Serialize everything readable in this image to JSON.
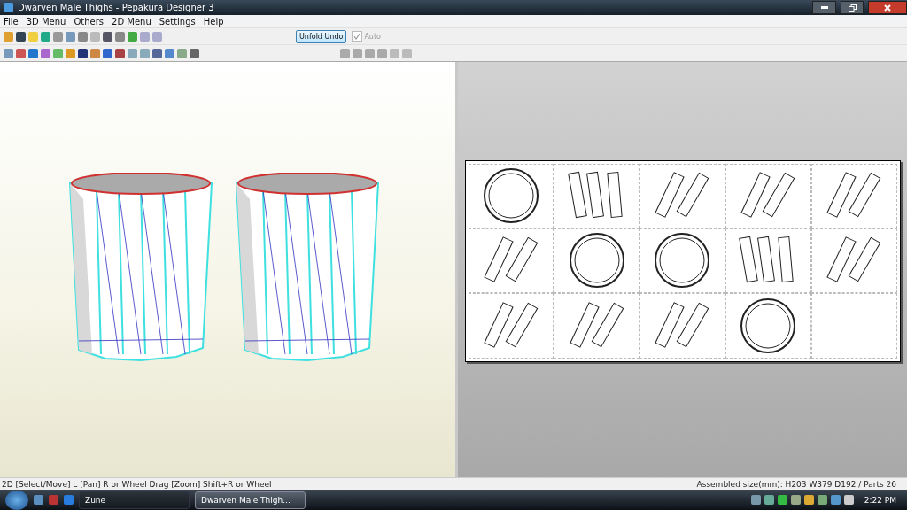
{
  "window": {
    "title": "Dwarven Male Thighs - Pepakura Designer 3"
  },
  "menu": [
    "File",
    "3D Menu",
    "Others",
    "2D Menu",
    "Settings",
    "Help"
  ],
  "unfold_undo": {
    "label": "Unfold Undo"
  },
  "auto": {
    "label": "Auto",
    "checked": true,
    "disabled": true
  },
  "sheet": {
    "cells": [
      {
        "kind": "ring"
      },
      {
        "kind": "trio"
      },
      {
        "kind": "pair"
      },
      {
        "kind": "pair"
      },
      {
        "kind": "pair"
      },
      {
        "kind": "pair"
      },
      {
        "kind": "ring"
      },
      {
        "kind": "ring"
      },
      {
        "kind": "trio"
      },
      {
        "kind": "pair"
      },
      {
        "kind": "pair"
      },
      {
        "kind": "pair"
      },
      {
        "kind": "pair"
      },
      {
        "kind": "ring"
      },
      {
        "kind": "empty"
      }
    ]
  },
  "status_bar": {
    "hint": "2D [Select/Move] L [Pan] R or Wheel Drag [Zoom] Shift+R or Wheel",
    "size": "Assembled size(mm): H203 W379 D192 / Parts 26"
  },
  "taskbar": {
    "items": [
      {
        "label": "Zune",
        "selected": false
      },
      {
        "label": "Dwarven Male Thigh...",
        "selected": true
      }
    ],
    "clock": "2:22 PM"
  }
}
